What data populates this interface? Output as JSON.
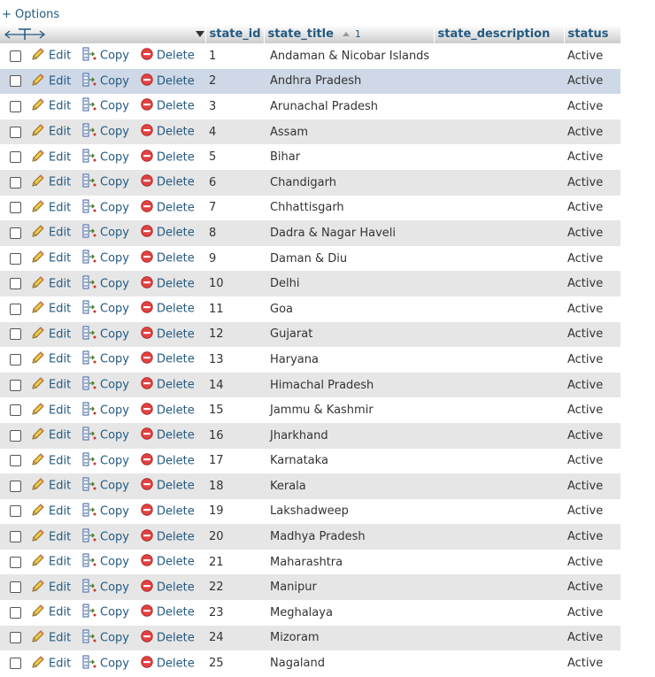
{
  "options_label": "+ Options",
  "header": {
    "col_state_id": "state_id",
    "col_state_title": "state_title",
    "sort_order": "1",
    "col_state_description": "state_description",
    "col_status": "status"
  },
  "actions": {
    "edit": "Edit",
    "copy": "Copy",
    "delete": "Delete"
  },
  "rows": [
    {
      "id": "1",
      "title": "Andaman & Nicobar Islands",
      "status": "Active"
    },
    {
      "id": "2",
      "title": "Andhra Pradesh",
      "status": "Active"
    },
    {
      "id": "3",
      "title": "Arunachal Pradesh",
      "status": "Active"
    },
    {
      "id": "4",
      "title": "Assam",
      "status": "Active"
    },
    {
      "id": "5",
      "title": "Bihar",
      "status": "Active"
    },
    {
      "id": "6",
      "title": "Chandigarh",
      "status": "Active"
    },
    {
      "id": "7",
      "title": "Chhattisgarh",
      "status": "Active"
    },
    {
      "id": "8",
      "title": "Dadra & Nagar Haveli",
      "status": "Active"
    },
    {
      "id": "9",
      "title": "Daman & Diu",
      "status": "Active"
    },
    {
      "id": "10",
      "title": "Delhi",
      "status": "Active"
    },
    {
      "id": "11",
      "title": "Goa",
      "status": "Active"
    },
    {
      "id": "12",
      "title": "Gujarat",
      "status": "Active"
    },
    {
      "id": "13",
      "title": "Haryana",
      "status": "Active"
    },
    {
      "id": "14",
      "title": "Himachal Pradesh",
      "status": "Active"
    },
    {
      "id": "15",
      "title": "Jammu & Kashmir",
      "status": "Active"
    },
    {
      "id": "16",
      "title": "Jharkhand",
      "status": "Active"
    },
    {
      "id": "17",
      "title": "Karnataka",
      "status": "Active"
    },
    {
      "id": "18",
      "title": "Kerala",
      "status": "Active"
    },
    {
      "id": "19",
      "title": "Lakshadweep",
      "status": "Active"
    },
    {
      "id": "20",
      "title": "Madhya Pradesh",
      "status": "Active"
    },
    {
      "id": "21",
      "title": "Maharashtra",
      "status": "Active"
    },
    {
      "id": "22",
      "title": "Manipur",
      "status": "Active"
    },
    {
      "id": "23",
      "title": "Meghalaya",
      "status": "Active"
    },
    {
      "id": "24",
      "title": "Mizoram",
      "status": "Active"
    },
    {
      "id": "25",
      "title": "Nagaland",
      "status": "Active"
    }
  ],
  "hovered_row": 2,
  "colors": {
    "link": "#235a81",
    "row_even": "#e6e6e6",
    "row_hover": "#ced8e6"
  }
}
